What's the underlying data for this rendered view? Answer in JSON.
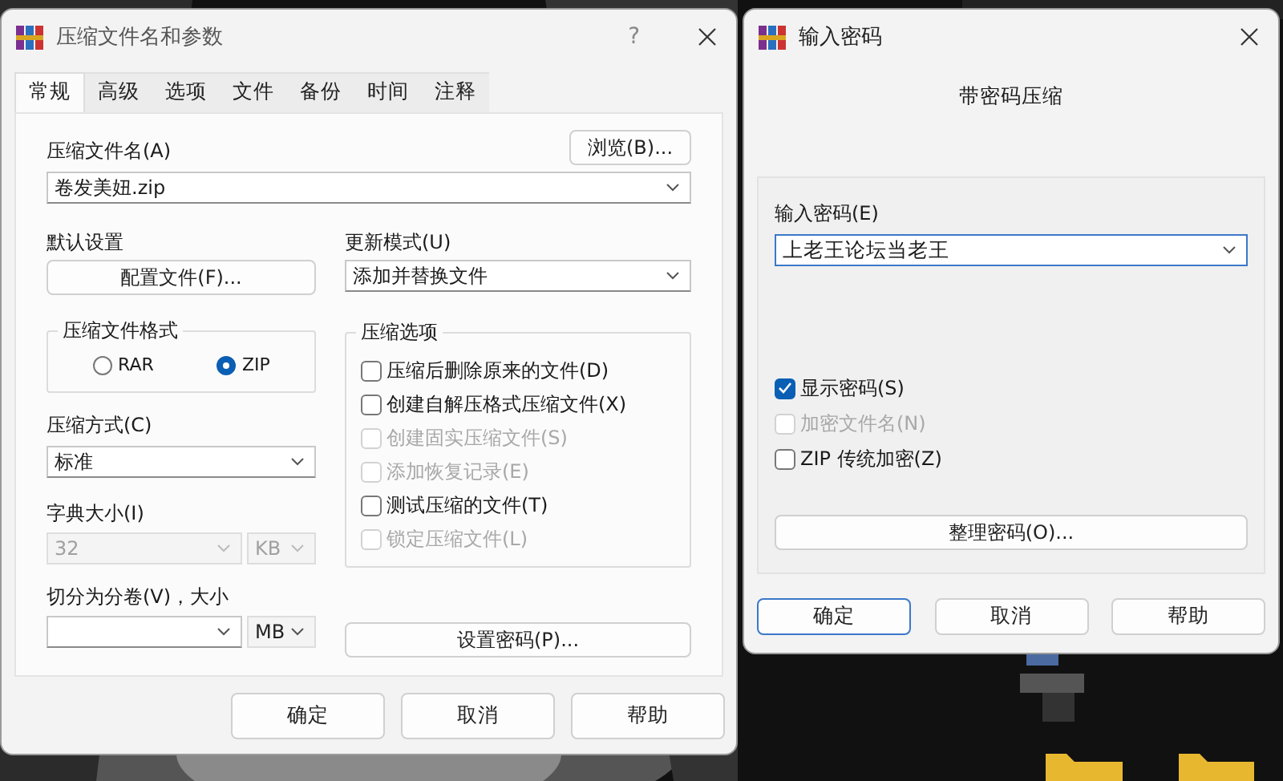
{
  "compress_dialog": {
    "title": "压缩文件名和参数",
    "help": "?",
    "tabs": [
      {
        "label": "常规",
        "selected": true
      },
      {
        "label": "高级",
        "selected": false
      },
      {
        "label": "选项",
        "selected": false
      },
      {
        "label": "文件",
        "selected": false
      },
      {
        "label": "备份",
        "selected": false
      },
      {
        "label": "时间",
        "selected": false
      },
      {
        "label": "注释",
        "selected": false
      }
    ],
    "archive_name": {
      "label": "压缩文件名(A)",
      "value": "卷发美妞.zip"
    },
    "browse_button": "浏览(B)...",
    "profile": {
      "label": "默认设置",
      "button": "配置文件(F)..."
    },
    "update_mode": {
      "label": "更新模式(U)",
      "value": "添加并替换文件"
    },
    "format": {
      "title": "压缩文件格式",
      "options": [
        {
          "label": "RAR",
          "selected": false
        },
        {
          "label": "ZIP",
          "selected": true
        }
      ]
    },
    "options": {
      "title": "压缩选项",
      "items": [
        {
          "label": "压缩后删除原来的文件(D)",
          "checked": false,
          "disabled": false
        },
        {
          "label": "创建自解压格式压缩文件(X)",
          "checked": false,
          "disabled": false
        },
        {
          "label": "创建固实压缩文件(S)",
          "checked": false,
          "disabled": true
        },
        {
          "label": "添加恢复记录(E)",
          "checked": false,
          "disabled": true
        },
        {
          "label": "测试压缩的文件(T)",
          "checked": false,
          "disabled": false
        },
        {
          "label": "锁定压缩文件(L)",
          "checked": false,
          "disabled": true
        }
      ]
    },
    "method": {
      "label": "压缩方式(C)",
      "value": "标准"
    },
    "dictionary": {
      "label": "字典大小(I)",
      "value": "32",
      "unit": "KB",
      "disabled": true
    },
    "split": {
      "label": "切分为分卷(V)，大小",
      "unit": "MB"
    },
    "password_button": "设置密码(P)...",
    "buttons": [
      {
        "label": "确定",
        "focused": false
      },
      {
        "label": "取消",
        "focused": false
      },
      {
        "label": "帮助",
        "focused": false
      }
    ]
  },
  "password_dialog": {
    "title": "输入密码",
    "heading": "带密码压缩",
    "password": {
      "label": "输入密码(E)",
      "value": "上老王论坛当老王"
    },
    "options": [
      {
        "label": "显示密码(S)",
        "checked": true,
        "disabled": false
      },
      {
        "label": "加密文件名(N)",
        "checked": false,
        "disabled": true
      },
      {
        "label": "ZIP 传统加密(Z)",
        "checked": false,
        "disabled": false
      }
    ],
    "organize_button": "整理密码(O)...",
    "buttons": [
      {
        "label": "确定",
        "focused": true
      },
      {
        "label": "取消",
        "focused": false
      },
      {
        "label": "帮助",
        "focused": false
      }
    ]
  }
}
